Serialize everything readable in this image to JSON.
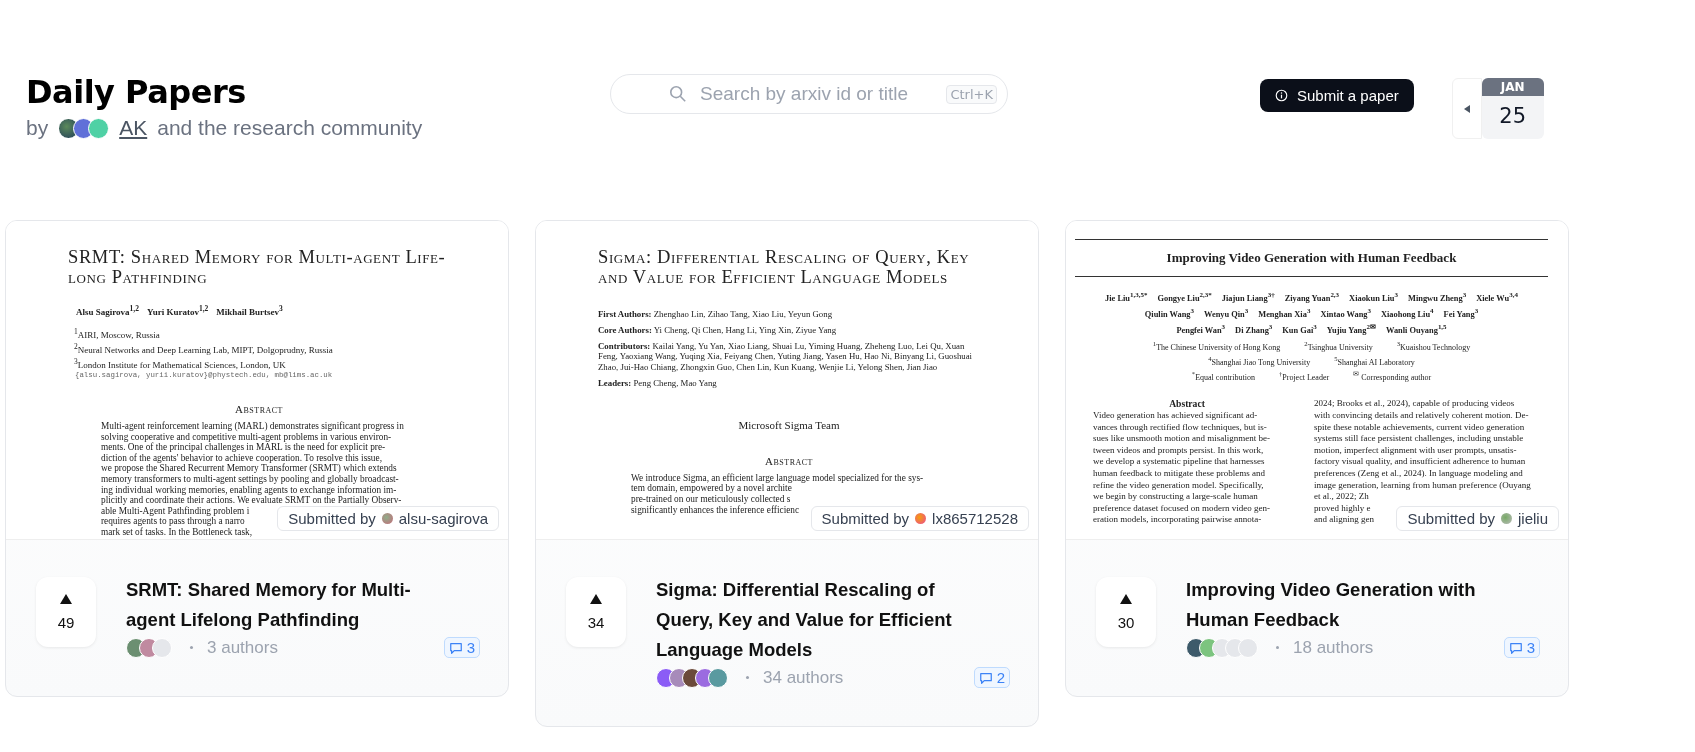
{
  "header": {
    "title": "Daily Papers",
    "byline": {
      "prefix": "by",
      "author": "AK",
      "suffix": "and the research community"
    },
    "search": {
      "placeholder": "Search by arxiv id or title",
      "shortcut": "Ctrl+K"
    },
    "submit_button": "Submit a paper",
    "date": {
      "month": "JAN",
      "day": "25"
    }
  },
  "papers": [
    {
      "page": [
        {
          "kind": "caps-title",
          "lines": [
            "SRMT: Shared Memory for Multi-agent Life-",
            "long Pathfinding"
          ]
        },
        {
          "kind": "author-line",
          "rows": [
            [
              "Alsu Sagirova$^{1,2}$",
              "Yuri Kuratov$^{1,2}$",
              "Mikhail Burtsev$^{3}$"
            ]
          ]
        },
        {
          "kind": "affiliations",
          "lines": [
            "$^{1}$AIRI, Moscow, Russia",
            "$^{2}$Neural Networks and Deep Learning Lab, MIPT, Dolgoprudny, Russia",
            "$^{3}$London Institute for Mathematical Sciences, London, UK"
          ]
        },
        {
          "kind": "email",
          "lines": [
            "{alsu.sagirova, yurii.kuratov}@phystech.edu, mb@lims.ac.uk"
          ]
        },
        {
          "kind": "heading",
          "lines": [
            "Abstract"
          ]
        },
        {
          "kind": "paragraph",
          "lines": [
            "Multi-agent reinforcement learning (MARL) demonstrates significant progress in",
            "solving cooperative and competitive multi-agent problems in various environ-",
            "ments. One of the principal challenges in MARL is the need for explicit pre-",
            "diction of the agents' behavior to achieve cooperation. To resolve this issue,",
            "we propose the Shared Recurrent Memory Transformer (SRMT) which extends",
            "memory transformers to multi-agent settings by pooling and globally broadcast-",
            "ing individual working memories, enabling agents to exchange information im-",
            "plicitly and coordinate their actions. We evaluate SRMT on the Partially Observ-",
            "able Multi-Agent Pathfinding problem i",
            "requires agents to pass through a narro",
            "mark set of tasks. In the Bottleneck task,"
          ]
        }
      ],
      "submitted": {
        "label": "Submitted by",
        "user": "alsu-sagirova"
      },
      "upvotes": "49",
      "title": "SRMT: Shared Memory for Multi-agent Lifelong Pathfinding",
      "avatars": [
        {
          "kind": "photo"
        },
        {
          "kind": "photo"
        },
        {
          "kind": "blank"
        }
      ],
      "authors": "3 authors",
      "comments": "3"
    },
    {
      "page": [
        {
          "kind": "caps-title",
          "lines": [
            "Sigma: Differential Rescaling of Query, Key",
            "and Value for Efficient Language Models"
          ]
        },
        {
          "kind": "labeled",
          "items": [
            "**First Authors:** Zhenghao Lin, Zihao Tang, Xiao Liu, Yeyun Gong",
            "**Core Authors:** Yi Cheng, Qi Chen, Hang Li, Ying Xin, Ziyue Yang",
            "**Contributors:** Kailai Yang, Yu Yan, Xiao Liang, Shuai Lu, Yiming Huang, Zheheng Luo, Lei Qu, Xuan Feng, Yaoxiang Wang, Yuqing Xia, Feiyang Chen, Yuting Jiang, Yasen Hu, Hao Ni, Binyang Li, Guoshuai Zhao, Jui-Hao Chiang, Zhongxin Guo, Chen Lin, Kun Kuang, Wenjie Li, Yelong Shen, Jian Jiao",
            "**Leaders:** Peng Cheng, Mao Yang"
          ]
        },
        {
          "kind": "note",
          "lines": [
            "Microsoft Sigma Team"
          ]
        },
        {
          "kind": "heading",
          "lines": [
            "Abstract"
          ]
        },
        {
          "kind": "paragraph",
          "lines": [
            "We introduce Sigma, an efficient large language model specialized for the sys-",
            "tem domain, empowered by a novel archite",
            "pre-trained on our meticulously collected s",
            "significantly enhances the inference efficienc"
          ]
        }
      ],
      "submitted": {
        "label": "Submitted by",
        "user": "lx865712528"
      },
      "upvotes": "34",
      "title": "Sigma: Differential Rescaling of Query, Key and Value for Efficient Language Models",
      "avatars": [
        {
          "kind": "photo"
        },
        {
          "kind": "photo"
        },
        {
          "kind": "photo"
        },
        {
          "kind": "photo"
        },
        {
          "kind": "photo"
        }
      ],
      "authors": "34 authors",
      "comments": "2"
    },
    {
      "page": [
        {
          "kind": "rule"
        },
        {
          "kind": "bold-title",
          "lines": [
            "Improving Video Generation with Human Feedback"
          ]
        },
        {
          "kind": "rule"
        },
        {
          "kind": "author-rows",
          "rows": [
            [
              "Jie Liu$^{1,3,5*}$",
              "Gongye Liu$^{2,3*}$",
              "Jiajun Liang$^{3†}$",
              "Ziyang Yuan$^{2,3}$",
              "Xiaokun Liu$^{3}$",
              "Mingwu Zheng$^{3}$",
              "Xiele Wu$^{3,4}$"
            ],
            [
              "Qiulin Wang$^{3}$",
              "Wenyu Qin$^{3}$",
              "Menghan Xia$^{3}$",
              "Xintao Wang$^{3}$",
              "Xiaohong Liu$^{4}$",
              "Fei Yang$^{3}$"
            ],
            [
              "Pengfei Wan$^{3}$",
              "Di Zhang$^{3}$",
              "Kun Gai$^{3}$",
              "Yujiu Yang$^{2✉}$",
              "Wanli Ouyang$^{1,5}$"
            ]
          ]
        },
        {
          "kind": "affiliation-rows",
          "rows": [
            [
              "$^{1}$The Chinese University of Hong Kong",
              "$^{2}$Tsinghua University",
              "$^{3}$Kuaishou Technology"
            ],
            [
              "$^{4}$Shanghai Jiao Tong University",
              "$^{5}$Shanghai AI Laboratory"
            ],
            [
              "$^{*}$Equal contribution",
              "$^{†}$Project Leader",
              "$^{✉}$ Corresponding author"
            ]
          ]
        },
        {
          "kind": "columns",
          "heading": "Abstract",
          "left": [
            "Video generation has achieved significant ad-",
            "vances through rectified flow techniques, but is-",
            "sues like unsmooth motion and misalignment be-",
            "tween videos and prompts persist. In this work,",
            "we develop a systematic pipeline that harnesses",
            "human feedback to mitigate these problems and",
            "refine the video generation model. Specifically,",
            "we begin by constructing a large-scale human",
            "preference dataset focused on modern video gen-",
            "eration models, incorporating pairwise annota-"
          ],
          "right": [
            "2024; Brooks et al., 2024), capable of producing videos",
            "with convincing details and relatively coherent motion. De-",
            "spite these notable achievements, current video generation",
            "systems still face persistent challenges, including unstable",
            "motion, imperfect alignment with user prompts, unsatis-",
            "factory visual quality, and insufficient adherence to human",
            "preferences (Zeng et al., 2024). In language modeling and",
            "image generation, learning from human preference (Ouyang",
            "et al., 2022; Zh",
            "proved highly e",
            "and aligning gen"
          ]
        }
      ],
      "submitted": {
        "label": "Submitted by",
        "user": "jieliu"
      },
      "upvotes": "30",
      "title": "Improving Video Generation with Human Feedback",
      "avatars": [
        {
          "kind": "photo"
        },
        {
          "kind": "photo"
        },
        {
          "kind": "blank"
        },
        {
          "kind": "blank"
        },
        {
          "kind": "blank"
        }
      ],
      "authors": "18 authors",
      "comments": "3"
    }
  ]
}
